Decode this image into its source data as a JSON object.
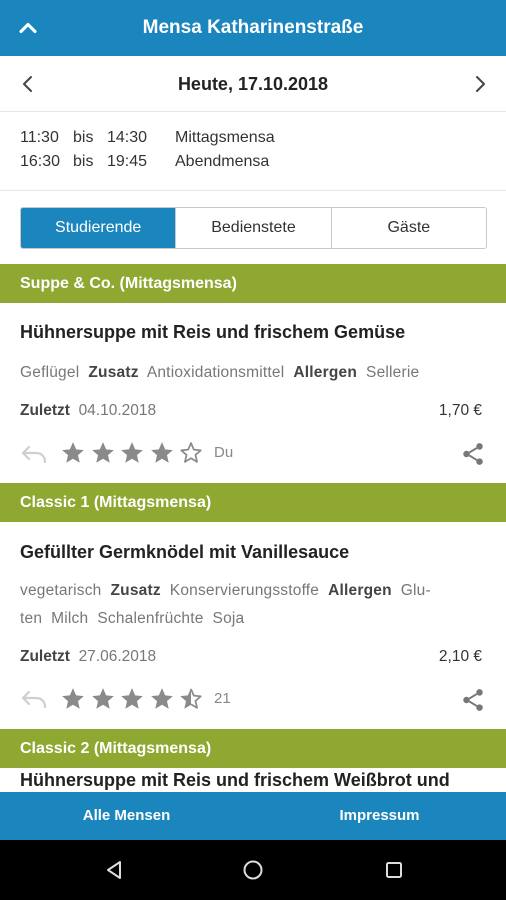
{
  "header": {
    "title": "Mensa Katharinenstraße",
    "collapse_icon": "chevron-up-icon"
  },
  "datebar": {
    "date": "Heute, 17.10.2018",
    "prev_icon": "chevron-left-icon",
    "next_icon": "chevron-right-icon"
  },
  "hours": [
    {
      "from": "11:30",
      "bis": "bis",
      "to": "14:30",
      "name": "Mittagsmensa"
    },
    {
      "from": "16:30",
      "bis": "bis",
      "to": "19:45",
      "name": "Abendmensa"
    }
  ],
  "tabs": [
    {
      "label": "Studierende",
      "active": true
    },
    {
      "label": "Bedienstete",
      "active": false
    },
    {
      "label": "Gäste",
      "active": false
    }
  ],
  "sections": [
    {
      "title": "Suppe & Co. (Mittagsmensa)",
      "meal": {
        "title": "Hühnersuppe mit Reis und frischem Gemüse",
        "tag_line_1": {
          "t1": "Geflügel",
          "label_zusatz": "Zusatz",
          "zusatz": "Antioxidationsmittel",
          "label_allergen": "Allergen",
          "allergen": "Sellerie"
        },
        "last_label": "Zuletzt",
        "last_date": "04.10.2018",
        "price": "1,70 €",
        "rating": 4,
        "rating_label": "Du"
      }
    },
    {
      "title": "Classic 1 (Mittagsmensa)",
      "meal": {
        "title": "Gefüllter Germknödel mit Vanillesauce",
        "tag_line_1": {
          "t1": "vegetarisch",
          "label_zusatz": "Zusatz",
          "zusatz": "Konservierungsstoffe",
          "label_allergen": "Allergen",
          "allergen": "Glu-"
        },
        "tag_line_2": "ten  Milch  Schalenfrüchte  Soja",
        "last_label": "Zuletzt",
        "last_date": "27.06.2018",
        "price": "2,10 €",
        "rating": 4.5,
        "rating_label": "21"
      }
    },
    {
      "title": "Classic 2 (Mittagsmensa)"
    }
  ],
  "peek_text": "Hühnersuppe mit Reis und frischem Weißbrot und",
  "bottombar": {
    "left": "Alle Mensen",
    "right": "Impressum"
  },
  "colors": {
    "primary": "#1b86bd",
    "section": "#8fa832"
  }
}
